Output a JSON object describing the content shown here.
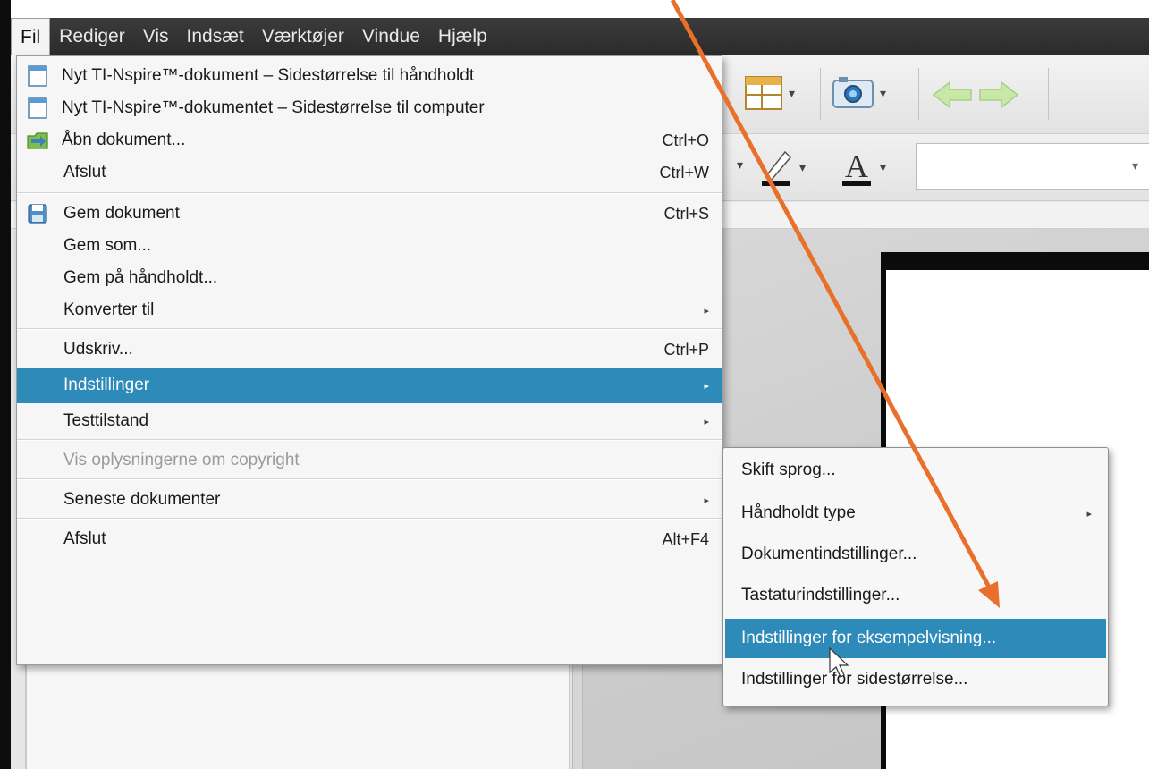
{
  "menubar": {
    "items": [
      "Fil",
      "Rediger",
      "Vis",
      "Indsæt",
      "Værktøjer",
      "Vindue",
      "Hjælp"
    ]
  },
  "file_menu": {
    "items": [
      {
        "label": "Nyt TI-Nspire™-dokument – Sidestørrelse til håndholdt",
        "shortcut": "",
        "icon": "new-document-icon"
      },
      {
        "label": "Nyt TI-Nspire™-dokumentet – Sidestørrelse til computer",
        "shortcut": "",
        "icon": "new-document-icon"
      },
      {
        "label": "Åbn dokument...",
        "shortcut": "Ctrl+O",
        "icon": "open-folder-icon"
      },
      {
        "label": "Afslut",
        "shortcut": "Ctrl+W",
        "icon": ""
      },
      {
        "label": "Gem dokument",
        "shortcut": "Ctrl+S",
        "icon": "save-disk-icon"
      },
      {
        "label": "Gem som...",
        "shortcut": "",
        "icon": ""
      },
      {
        "label": "Gem på håndholdt...",
        "shortcut": "",
        "icon": ""
      },
      {
        "label": "Konverter til",
        "shortcut": "",
        "icon": ""
      },
      {
        "label": "Udskriv...",
        "shortcut": "Ctrl+P",
        "icon": ""
      },
      {
        "label": "Indstillinger",
        "shortcut": "",
        "icon": ""
      },
      {
        "label": "Testtilstand",
        "shortcut": "",
        "icon": ""
      },
      {
        "label": "Vis oplysningerne om copyright",
        "shortcut": "",
        "icon": ""
      },
      {
        "label": "Seneste dokumenter",
        "shortcut": "",
        "icon": ""
      },
      {
        "label": "Afslut",
        "shortcut": "Alt+F4",
        "icon": ""
      }
    ]
  },
  "settings_submenu": {
    "items": [
      {
        "label": "Skift sprog..."
      },
      {
        "label": "Håndholdt type"
      },
      {
        "label": "Dokumentindstillinger..."
      },
      {
        "label": "Tastaturindstillinger..."
      },
      {
        "label": "Indstillinger for eksempelvisning..."
      },
      {
        "label": "Indstillinger for sidestørrelse..."
      }
    ]
  },
  "colors": {
    "menubar": "#2f2f2f",
    "highlight": "#2e8ab8",
    "annotation_arrow": "#e8702a"
  }
}
